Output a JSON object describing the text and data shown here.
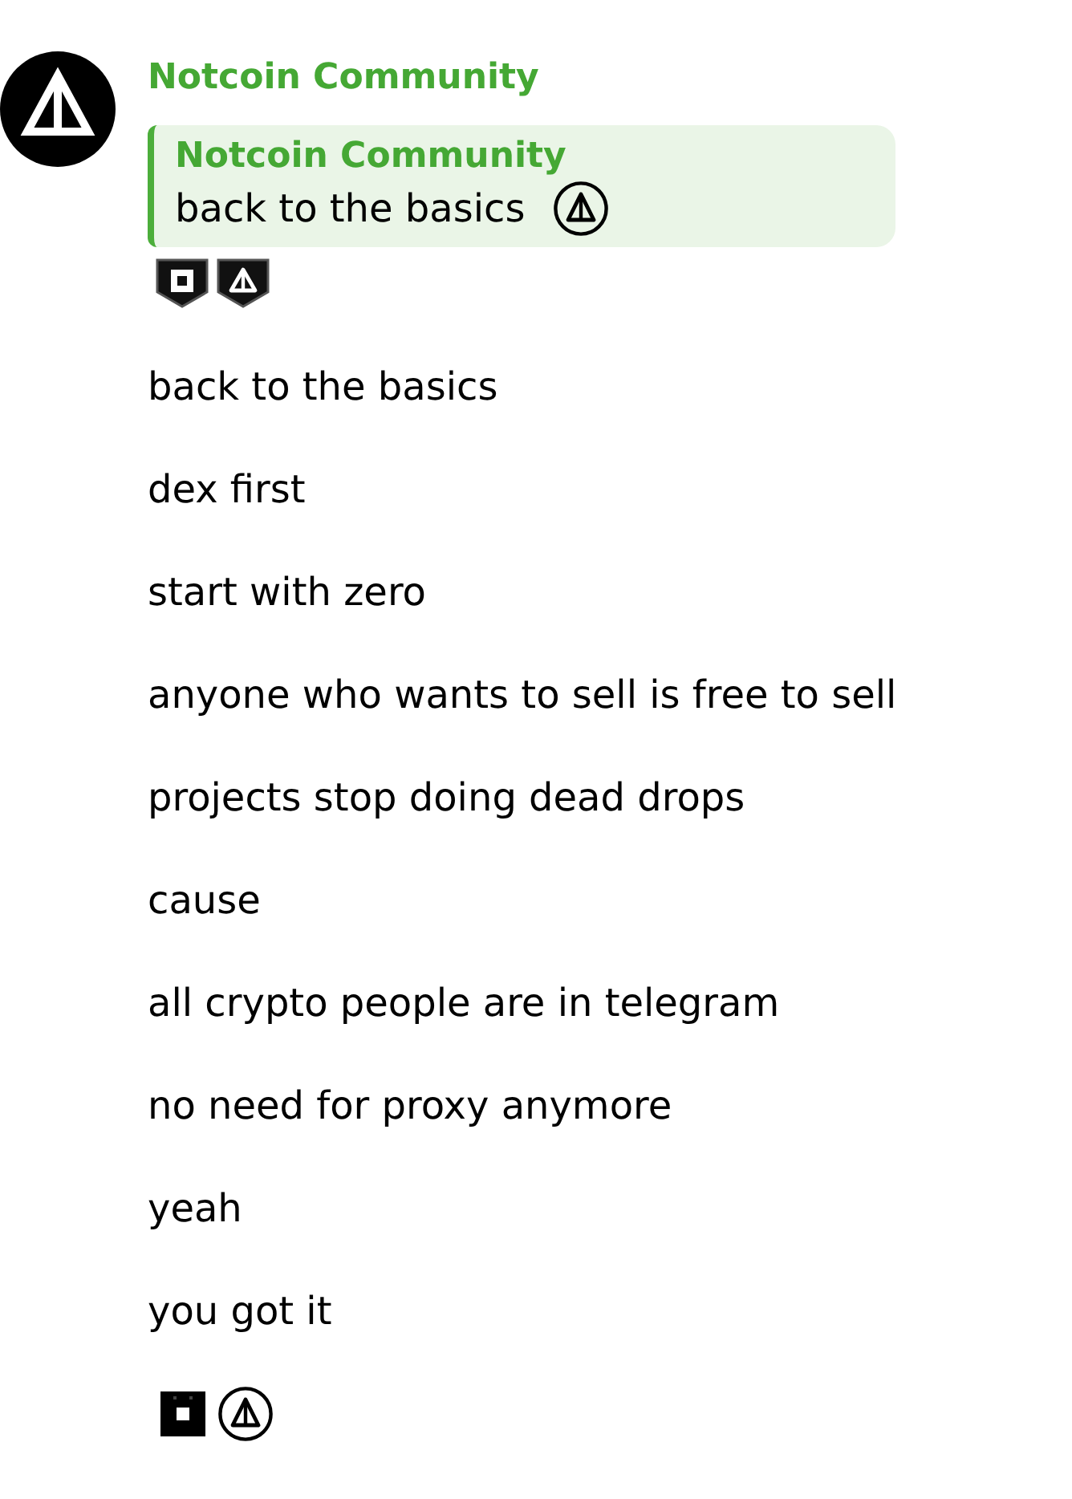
{
  "message": {
    "sender": "Notcoin Community",
    "reply": {
      "sender": "Notcoin Community",
      "text": "back to the basics"
    },
    "lines": [
      "back to the basics",
      "dex first",
      "start with zero",
      "anyone who wants to sell is free to sell",
      "projects stop doing dead drops",
      "cause",
      "all crypto people are in telegram",
      "no need for proxy anymore",
      "yeah",
      "you got it"
    ]
  }
}
